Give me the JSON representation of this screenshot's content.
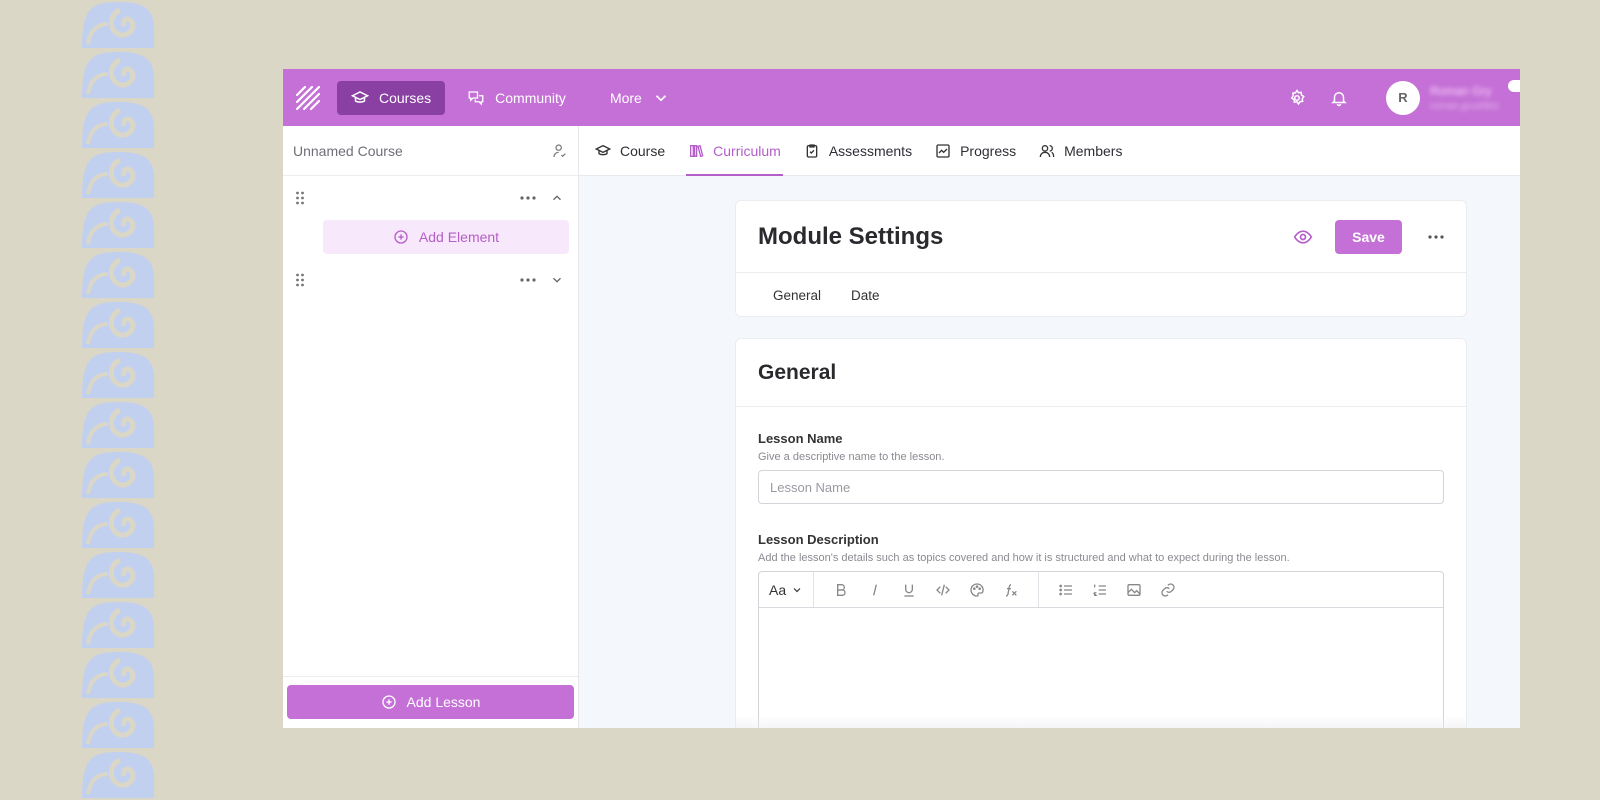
{
  "topbar": {
    "nav": [
      {
        "label": "Courses",
        "icon": "graduation-cap-icon",
        "active": true
      },
      {
        "label": "Community",
        "icon": "chat-bubbles-icon",
        "active": false
      },
      {
        "label": "More",
        "icon": "chevron-down-icon",
        "active": false
      }
    ],
    "avatar_initial": "R",
    "user_name": "Roman Gry",
    "user_email": "roman.grushkin"
  },
  "sidebar": {
    "course_title": "Unnamed Course",
    "add_element_label": "Add Element",
    "add_lesson_label": "Add Lesson"
  },
  "tabs": [
    {
      "label": "Course",
      "icon": "graduation-cap-icon"
    },
    {
      "label": "Curriculum",
      "icon": "books-icon",
      "active": true
    },
    {
      "label": "Assessments",
      "icon": "clipboard-icon"
    },
    {
      "label": "Progress",
      "icon": "chart-icon"
    },
    {
      "label": "Members",
      "icon": "users-icon"
    }
  ],
  "module": {
    "title": "Module Settings",
    "save_label": "Save",
    "subtabs": [
      "General",
      "Date"
    ]
  },
  "general": {
    "title": "General",
    "lesson_name_label": "Lesson Name",
    "lesson_name_help": "Give a descriptive name to the lesson.",
    "lesson_name_placeholder": "Lesson Name",
    "lesson_desc_label": "Lesson Description",
    "lesson_desc_help": "Add the lesson's details such as topics covered and how it is structured and what to expect during the lesson.",
    "font_button": "Aa"
  },
  "colors": {
    "accent": "#c470d6",
    "accent_dark": "#8a3fa3",
    "background": "#dad7c6",
    "pattern": "#c2d0f0"
  }
}
